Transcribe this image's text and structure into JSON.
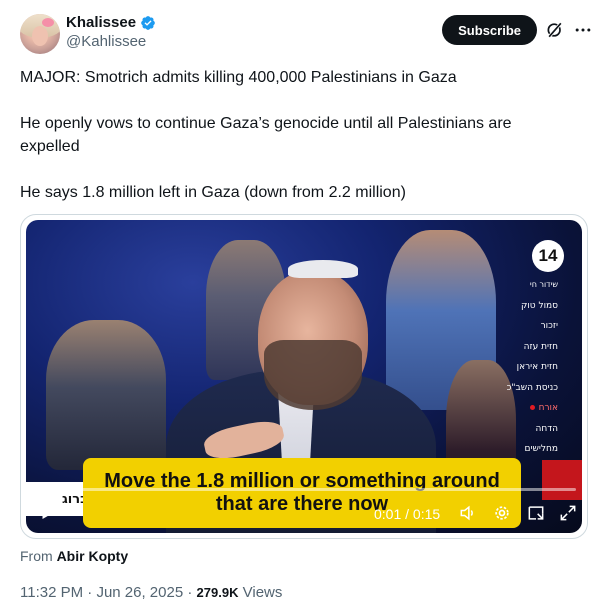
{
  "header": {
    "display_name": "Khalissee",
    "handle": "@Kahlissee",
    "subscribe_label": "Subscribe",
    "icons": [
      "verified-badge-icon",
      "grok-icon",
      "more-icon"
    ],
    "verified_color": "#1d9bf0"
  },
  "tweet": {
    "line1": "MAJOR: Smotrich admits killing 400,000 Palestinians in Gaza",
    "line2": "He openly vows to continue Gaza’s genocide until all Palestinians are expelled",
    "line3": "He says 1.8 million left in Gaza (down from 2.2 million)"
  },
  "video": {
    "channel_logo": "14",
    "channel_menu": [
      "שידור חי",
      "סמול טוק",
      "יזכור",
      "חזית עזה",
      "חזית איראן",
      "כניסת השב\"כ",
      "אורח",
      "הדחה",
      "מחלישים"
    ],
    "active_menu_index": 6,
    "ticker_text": "ברוג",
    "caption": "Move the 1.8 million or something around that are there now",
    "time": "0:01 / 0:15",
    "progress": 0.067,
    "caption_color": "#f2d000"
  },
  "source": {
    "label": "From",
    "name": "Abir Kopty"
  },
  "meta": {
    "time": "11:32 PM",
    "date": "Jun 26, 2025",
    "views_count": "279.9K",
    "views_label": "Views",
    "separator": "·"
  }
}
